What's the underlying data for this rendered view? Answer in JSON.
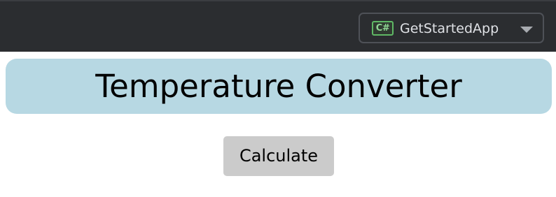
{
  "toolbar": {
    "run_configuration": {
      "icon": "csharp-project-icon",
      "icon_text": "C#",
      "label": "GetStartedApp",
      "dropdown_icon": "triangle-down-icon"
    }
  },
  "main": {
    "title": "Temperature Converter",
    "calculate_button_label": "Calculate"
  },
  "colors": {
    "toolbar_background": "#2b2d30",
    "banner_background": "#b7d8e3",
    "button_background": "#cbcbcb",
    "csharp_icon": "#5fb865"
  }
}
